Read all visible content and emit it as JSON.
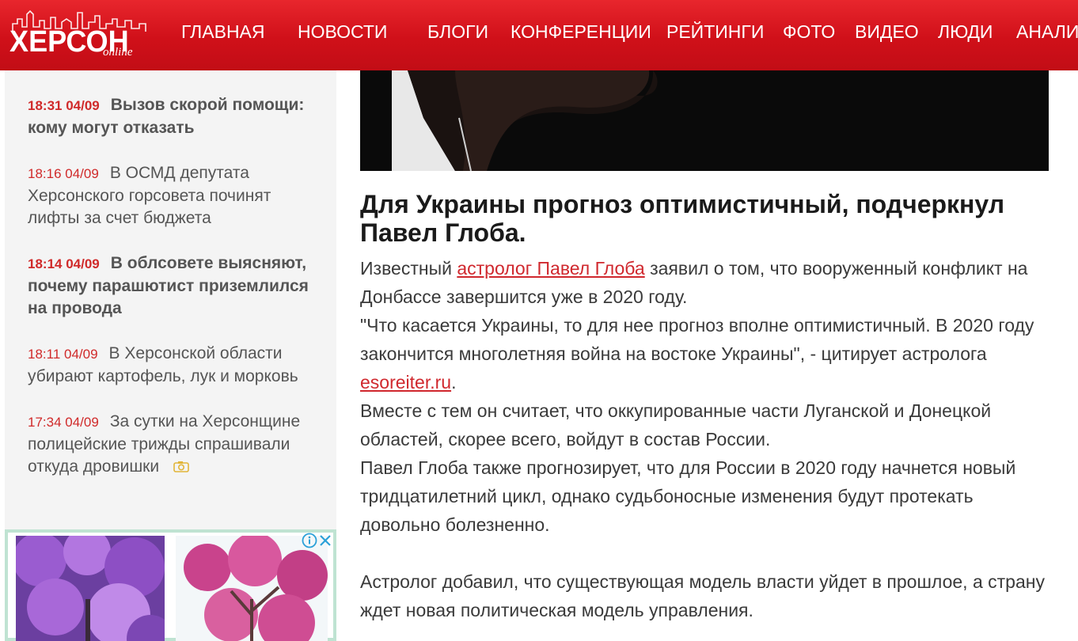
{
  "header": {
    "logo_main": "ХЕРСОН",
    "logo_sub": "online",
    "nav": [
      {
        "label": "ГЛАВНАЯ"
      },
      {
        "label": "НОВОСТИ"
      },
      {
        "label": "БЛОГИ"
      },
      {
        "label": "КОНФЕРЕНЦИИ"
      },
      {
        "label": "РЕЙТИНГИ"
      },
      {
        "label": "ФОТО"
      },
      {
        "label": "ВИДЕО"
      },
      {
        "label": "ЛЮДИ"
      },
      {
        "label": "АНАЛИ"
      }
    ],
    "colors": {
      "bar": "#d01019",
      "text": "#ffffff"
    }
  },
  "sidebar": {
    "news": [
      {
        "time": "18:31 04/09",
        "title": "Вызов скорой помощи: кому могут отказать",
        "bold": true
      },
      {
        "time": "18:16 04/09",
        "title": "В ОСМД депутата Херсонского горсовета починят лифты за счет бюджета",
        "bold": false
      },
      {
        "time": "18:14 04/09",
        "title": "В облсовете выясняют, почему парашютист приземлился на провода",
        "bold": true
      },
      {
        "time": "18:11 04/09",
        "title": "В Херсонской области убирают картофель, лук и морковь",
        "bold": false
      },
      {
        "time": "17:34 04/09",
        "title": "За сутки на Херсонщине полицейские трижды спрашивали откуда дровишки",
        "bold": false,
        "icon": "camera-icon"
      }
    ],
    "ad": {
      "info_icon": "info-icon",
      "close_icon": "close-icon"
    }
  },
  "article": {
    "headline": "Для Украины прогноз оптимистичный, подчеркнул Павел Глоба.",
    "p1_before": "Известный ",
    "p1_link": "астролог Павел Глоба",
    "p1_after": " заявил о том, что вооруженный конфликт на Донбассе завершится уже в 2020 году.",
    "p2_before": "\"Что касается Украины, то для нее прогноз вполне оптимистичный. В 2020 году закончится многолетняя война на востоке Украины\", - цитирует астролога ",
    "p2_link": "esoreiter.ru",
    "p2_after": ".",
    "p3": "Вместе с тем он считает, что оккупированные части Луганской и Донецкой областей, скорее всего, войдут в состав России.",
    "p4": "Павел Глоба также прогнозирует, что для России в 2020 году начнется новый тридцатилетний цикл, однако судьбоносные изменения будут протекать довольно болезненно.",
    "p5": "Астролог добавил, что существующая модель власти уйдет в прошлое, а страну ждет новая политическая модель управления.",
    "link_color": "#d0282e"
  }
}
